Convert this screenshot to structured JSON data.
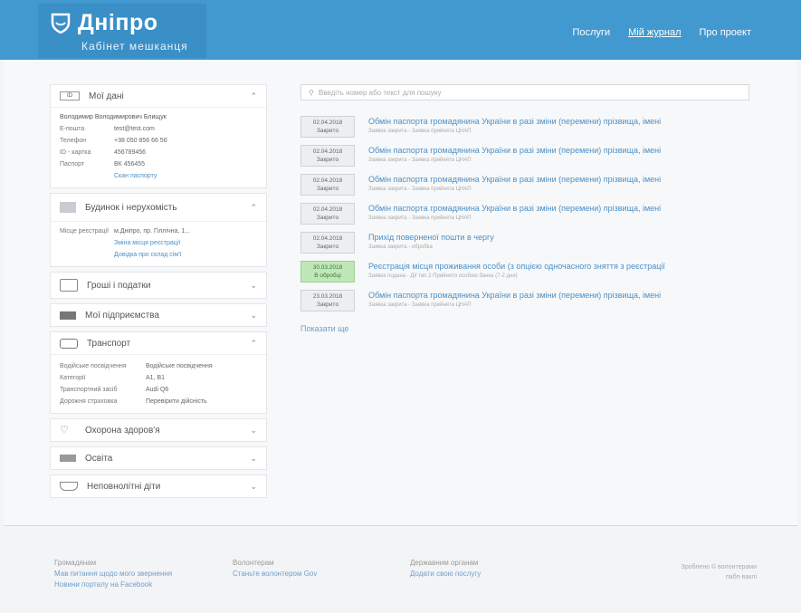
{
  "header": {
    "logo_title": "Дніпро",
    "logo_subtitle": "Кабінет мешканця",
    "nav": [
      "Послуги",
      "Мій журнал",
      "Про проект"
    ]
  },
  "sidebar": {
    "personal": {
      "title": "Мої дані",
      "name": "Володимир Володимирович Блищук",
      "fields": [
        {
          "label": "E-пошта",
          "value": "test@test.com"
        },
        {
          "label": "Телефон",
          "value": "+38 050 856 66 56"
        },
        {
          "label": "ID - картка",
          "value": "456789456"
        },
        {
          "label": "Паспорт",
          "value": "ВК 456455"
        }
      ],
      "link": "Скан паспорту"
    },
    "property": {
      "title": "Будинок і нерухомість",
      "reg_label": "Місце реєстрації",
      "reg_value": "м.Дніпро, пр. Гіллічна, 1...",
      "links": [
        "Зміна місця реєстрації",
        "Довідка про склад сім'ї"
      ]
    },
    "collapsed_1": [
      {
        "title": "Гроші і податки"
      },
      {
        "title": "Мої підприємства"
      }
    ],
    "transport": {
      "title": "Транспорт",
      "fields": [
        {
          "label": "Водійське посвідчення",
          "value": "Водійське посвідчення"
        },
        {
          "label": "Категорії",
          "value": "A1, B1"
        },
        {
          "label": "Транспортний засіб",
          "value": "Audi Q6"
        },
        {
          "label": "Дорожня страховка",
          "value": "Перевірити дійсність"
        }
      ]
    },
    "collapsed_2": [
      {
        "title": "Охорона здоров'я"
      },
      {
        "title": "Освіта"
      },
      {
        "title": "Неповнолітні діти"
      }
    ]
  },
  "main": {
    "search_placeholder": "Введіть номер або текст для пошуку",
    "journal": [
      {
        "date": "02.04.2018",
        "status": "Закрито",
        "title": "Обмін паспорта громадянина України в разі зміни (перемени) прізвища, імені",
        "sub": "Заявка закрита - Заявка прийнята ЦНАП"
      },
      {
        "date": "02.04.2018",
        "status": "Закрито",
        "title": "Обмін паспорта громадянина України в разі зміни (перемени) прізвища, імені",
        "sub": "Заявка закрита - Заявка прийнята ЦНАП"
      },
      {
        "date": "02.04.2018",
        "status": "Закрито",
        "title": "Обмін паспорта громадянина України в разі зміни (перемени) прізвища, імені",
        "sub": "Заявка закрита - Заявка прийнята ЦНАП"
      },
      {
        "date": "02.04.2018",
        "status": "Закрито",
        "title": "Обмін паспорта громадянина України в разі зміни (перемени) прізвища, імені",
        "sub": "Заявка закрита - Заявка прийнята ЦНАП"
      },
      {
        "date": "02.04.2018",
        "status": "Закрито",
        "title": "Прихід поверненої пошти в чергу",
        "sub": "Заявка закрита - обробка"
      },
      {
        "date": "30.03.2018",
        "status": "В обробці",
        "ok": true,
        "title": "Реєстрація місця проживання особи (з опцією одночасного зняття з реєстрації",
        "sub": "Заявка подана - Дії тип 2 Прийнято особою банка (7-2 дня)"
      },
      {
        "date": "23.03.2018",
        "status": "Закрито",
        "title": "Обмін паспорта громадянина України в разі зміни (перемени) прізвища, імені",
        "sub": "Заявка закрита - Заявка прийнята ЦНАП"
      }
    ],
    "show_all": "Показати ще"
  },
  "footer": {
    "col1_title": "Громадянам",
    "col1_links": [
      "Мав питання щодо мого звернення",
      "Новини порталу на Facebook"
    ],
    "col2_title": "Волонтерам",
    "col2_links": [
      "Станьте волонтером Gov"
    ],
    "col3_title": "Державним органам",
    "col3_links": [
      "Додати свою послугу"
    ],
    "credit_line1": "Зроблено © волонтерами",
    "credit_line2": "пабл-ваклі"
  },
  "colors": {
    "header": "#4299cf",
    "link": "#4d8fc6",
    "ok_badge": "#bfe7b8"
  }
}
